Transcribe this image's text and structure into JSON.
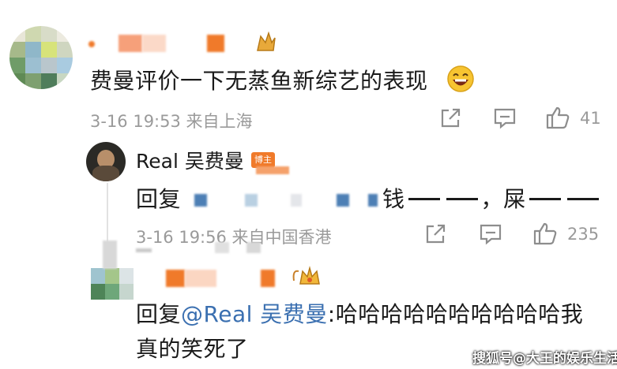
{
  "comment": {
    "text": "费曼评价一下无蒸鱼新综艺的表现",
    "emoji_icon": "laughing-face-icon",
    "meta": "3-16 19:53 来自上海",
    "like_count": "41"
  },
  "reply1": {
    "author": "Real 吴费曼",
    "badge": "博主",
    "prefix": "回复",
    "mid_text": "钱",
    "comma": "，",
    "end_text": "屎",
    "meta": "3-16 19:56 来自中国香港",
    "like_count": "235"
  },
  "reply2": {
    "prefix": "回复",
    "mention": "@Real 吴费曼",
    "text_line1": ":哈哈哈哈哈哈哈哈哈哈我",
    "text_line2": "真的笑死了"
  },
  "watermark": "搜狐号@大王的娱乐生活",
  "colors": {
    "mention": "#3a6fb0",
    "meta_gray": "#9a9a9a",
    "censor_orange": "#f07a2a"
  }
}
